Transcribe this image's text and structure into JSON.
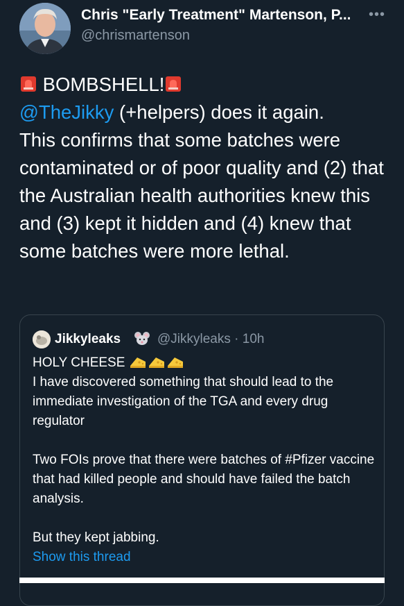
{
  "author": {
    "name": "Chris \"Early Treatment\" Martenson, P...",
    "handle": "@chrismartenson"
  },
  "menu_icon": "more-horizontal-icon",
  "tweet": {
    "headline": " BOMBSHELL!",
    "mention": "@TheJikky",
    "line1_rest": " (+helpers) does it again.",
    "body": "This confirms that some batches were contaminated or of poor quality and (2) that the Australian health authorities knew this and (3) kept it hidden and (4) knew that some batches were more lethal."
  },
  "quoted": {
    "name": "Jikkyleaks",
    "handle_time": "@Jikkyleaks · 10h",
    "line1": "HOLY CHEESE ",
    "para1": "I have discovered something that should lead to the immediate investigation of the TGA and every drug regulator",
    "para2": "Two FOIs prove that there were batches of #Pfizer vaccine that had killed people and should have failed the batch analysis.",
    "para3": "But they kept jabbing.",
    "show_thread": "Show this thread"
  },
  "colors": {
    "background": "#15202b",
    "link": "#1d9bf0",
    "muted": "#8b98a5",
    "border": "#38444d"
  }
}
